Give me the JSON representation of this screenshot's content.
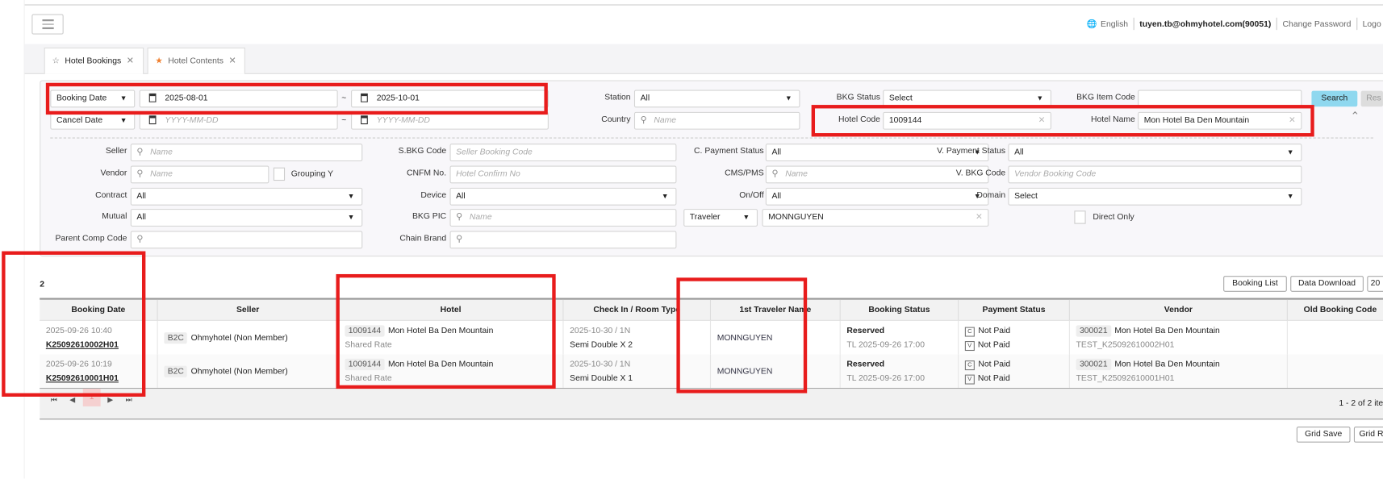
{
  "header": {
    "language": "English",
    "user": "tuyen.tb@ohmyhotel.com(90051)",
    "change_password": "Change Password",
    "logout": "Logo"
  },
  "tabs": [
    {
      "label": "Hotel Bookings",
      "active": true,
      "icon": "star-outline-icon"
    },
    {
      "label": "Hotel Contents",
      "active": false,
      "icon": "star-filled-icon"
    }
  ],
  "filters": {
    "date1_type": "Booking Date",
    "date1_from": "2025-08-01",
    "date_sep": "~",
    "date1_to": "2025-10-01",
    "date2_type": "Cancel Date",
    "date2_placeholder": "YYYY-MM-DD",
    "station_label": "Station",
    "station_value": "All",
    "country_label": "Country",
    "country_placeholder": "Name",
    "bkg_status_label": "BKG Status",
    "bkg_status_value": "Select",
    "bkg_item_code_label": "BKG Item Code",
    "bkg_item_code_value": "",
    "hotel_code_label": "Hotel Code",
    "hotel_code_value": "1009144",
    "hotel_name_label": "Hotel Name",
    "hotel_name_value": "Mon Hotel Ba Den Mountain",
    "search": "Search",
    "reset": "Res",
    "seller_label": "Seller",
    "seller_placeholder": "Name",
    "vendor_label": "Vendor",
    "vendor_placeholder": "Name",
    "grouping_label": "Grouping Y",
    "contract_label": "Contract",
    "contract_value": "All",
    "mutual_label": "Mutual",
    "mutual_value": "All",
    "parent_comp_label": "Parent Comp Code",
    "sbkg_label": "S.BKG Code",
    "sbkg_placeholder": "Seller Booking Code",
    "cnfm_label": "CNFM No.",
    "cnfm_placeholder": "Hotel Confirm No",
    "device_label": "Device",
    "device_value": "All",
    "bkg_pic_label": "BKG PIC",
    "bkg_pic_placeholder": "Name",
    "chain_brand_label": "Chain Brand",
    "c_payment_label": "C. Payment Status",
    "c_payment_value": "All",
    "cms_label": "CMS/PMS",
    "cms_placeholder": "Name",
    "onoff_label": "On/Off",
    "onoff_value": "All",
    "traveler_type": "Traveler",
    "traveler_value": "MONNGUYEN",
    "v_payment_label": "V. Payment Status",
    "v_payment_value": "All",
    "v_bkg_label": "V. BKG Code",
    "v_bkg_placeholder": "Vendor Booking Code",
    "domain_label": "Domain",
    "domain_value": "Select",
    "direct_only_label": "Direct Only"
  },
  "results": {
    "count": "2",
    "booking_list": "Booking List",
    "data_download": "Data Download",
    "extra_btn": "20",
    "columns": [
      "Booking Date",
      "Seller",
      "Hotel",
      "Check In / Room Type",
      "1st Traveler Name",
      "Booking Status",
      "Payment Status",
      "Vendor",
      "Old Booking Code"
    ],
    "rows": [
      {
        "date": "2025-09-26 10:40",
        "code": "K25092610002H01",
        "seller_type": "B2C",
        "seller": "Ohmyhotel (Non Member)",
        "hotel_code": "1009144",
        "hotel": "Mon Hotel Ba Den Mountain",
        "rate": "Shared Rate",
        "checkin": "2025-10-30 / 1N",
        "room": "Semi Double X 2",
        "traveler": "MONNGUYEN",
        "status": "Reserved",
        "tl": "TL 2025-09-26 17:00",
        "c_tag": "C",
        "c_pay": "Not Paid",
        "v_tag": "V",
        "v_pay": "Not Paid",
        "vendor_code": "300021",
        "vendor": "Mon Hotel Ba Den Mountain",
        "vendor_bkg": "TEST_K25092610002H01",
        "old": ""
      },
      {
        "date": "2025-09-26 10:19",
        "code": "K25092610001H01",
        "seller_type": "B2C",
        "seller": "Ohmyhotel (Non Member)",
        "hotel_code": "1009144",
        "hotel": "Mon Hotel Ba Den Mountain",
        "rate": "Shared Rate",
        "checkin": "2025-10-30 / 1N",
        "room": "Semi Double X 1",
        "traveler": "MONNGUYEN",
        "status": "Reserved",
        "tl": "TL 2025-09-26 17:00",
        "c_tag": "C",
        "c_pay": "Not Paid",
        "v_tag": "V",
        "v_pay": "Not Paid",
        "vendor_code": "300021",
        "vendor": "Mon Hotel Ba Den Mountain",
        "vendor_bkg": "TEST_K25092610001H01",
        "old": ""
      }
    ],
    "page": "1",
    "range": "1 - 2 of 2 ite",
    "grid_save": "Grid Save",
    "grid_reset": "Grid R"
  },
  "colors": {
    "highlight": "#e81c1c",
    "search_button": "#8fd8ef"
  }
}
